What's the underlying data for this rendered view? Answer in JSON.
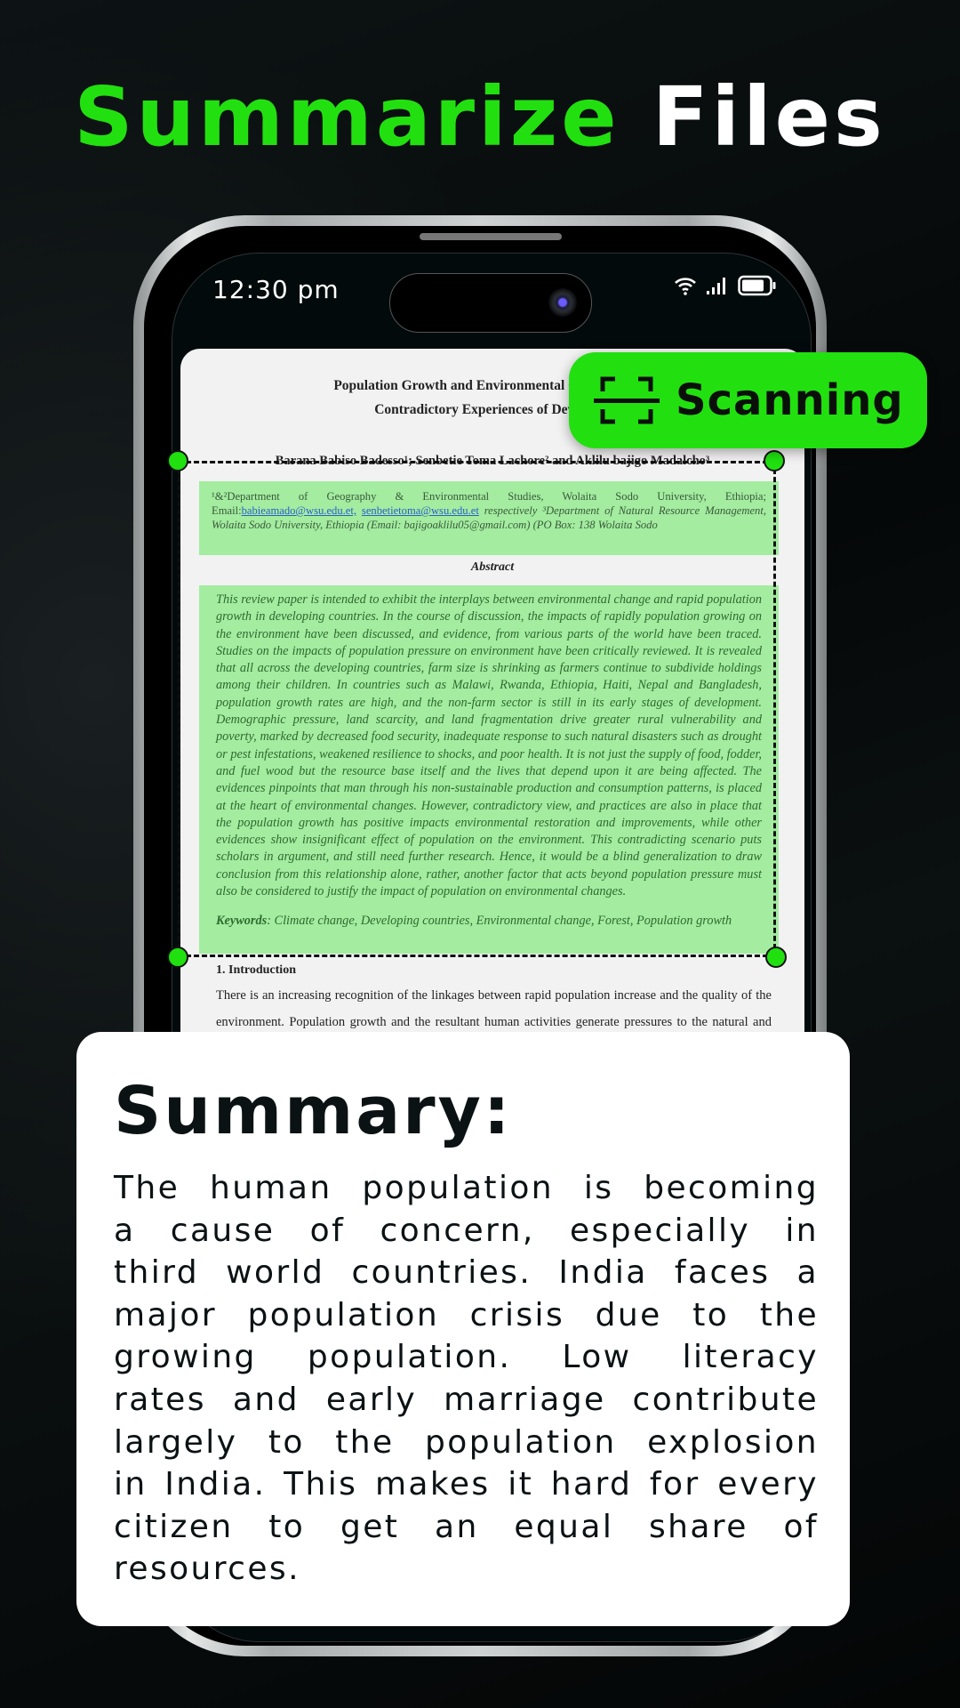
{
  "headline": {
    "accent": "Summarize",
    "rest": "Files"
  },
  "colors": {
    "accent": "#22e010",
    "highlight": "#a3eca0",
    "background": "#05090a"
  },
  "status_bar": {
    "time": "12:30 pm",
    "icons": [
      "wifi-icon",
      "signal-icon",
      "battery-icon"
    ]
  },
  "badge": {
    "label": "Scanning",
    "icon": "scan-icon"
  },
  "document": {
    "title_line1": "Population Growth and Environmental Changes: Con",
    "title_line2": "Contradictory Experiences of Developin",
    "authors": "Barana Babiso Badesso¹; Senbetie Toma Lachore² and Aklilu bajigo Madalcho³",
    "affiliation_pre": "¹&²Department of Geography & Environmental Studies, Wolaita Sodo University, Ethiopia; Email:",
    "email1": "babieamado@wsu.edu.et,",
    "email2": "senbetietoma@wsu.edu.et",
    "affiliation_post": "respectively ³Department of Natural Resource Management, Wolaita Sodo University, Ethiopia (Email: bajigoaklilu05@gmail.com) (PO Box: 138 Wolaita Sodo",
    "abstract_heading": "Abstract",
    "abstract": "This review paper is intended to exhibit the interplays between environmental change and rapid population growth in developing countries. In the course of discussion, the impacts of rapidly population growing on the environment have been discussed, and evidence, from various parts of the world have been traced. Studies on the impacts of population pressure on environment have been critically reviewed. It is revealed that all across the developing countries, farm size is shrinking as farmers continue to subdivide holdings among their children. In countries such as Malawi, Rwanda, Ethiopia, Haiti, Nepal and Bangladesh, population growth rates are high, and the non-farm sector is still in its early stages of development. Demographic pressure, land scarcity, and land fragmentation drive greater rural vulnerability and poverty, marked by decreased food security, inadequate response to such natural disasters such as drought or pest infestations, weakened resilience to shocks, and poor health. It is not just the supply of food, fodder, and fuel wood but the resource base itself and the lives that depend upon it are being affected. The evidences pinpoints that man through his non-sustainable production and consumption patterns, is placed at the heart of environmental changes. However, contradictory view, and practices are also in place that the population growth has positive impacts environmental restoration and improvements, while other evidences show insignificant effect of population on the environment. This contradicting scenario puts scholars in argument, and still need further research. Hence, it would be a blind generalization to draw conclusion from this relationship alone, rather, another factor that acts beyond population pressure must also be considered to justify the impact of population on environmental changes.",
    "keywords_label": "Keywords",
    "keywords": ": Climate change, Developing countries, Environmental change, Forest, Population growth",
    "intro_heading": "1. Introduction",
    "intro": "There is an increasing recognition of the linkages between rapid population increase and the quality of the environment. Population growth and the resultant human activities generate pressures to the natural and man made environments. This statement is demonstrated by the"
  },
  "summary": {
    "heading": "Summary:",
    "lines": [
      "The human population is becoming",
      "a cause of concern, especially in",
      "third world countries. India faces a",
      "major population crisis due to the",
      "growing population. Low literacy",
      "rates and early marriage contribute",
      "largely to the population explosion",
      "in India. This makes it hard for every",
      "citizen to get an equal share of",
      "resources."
    ]
  }
}
